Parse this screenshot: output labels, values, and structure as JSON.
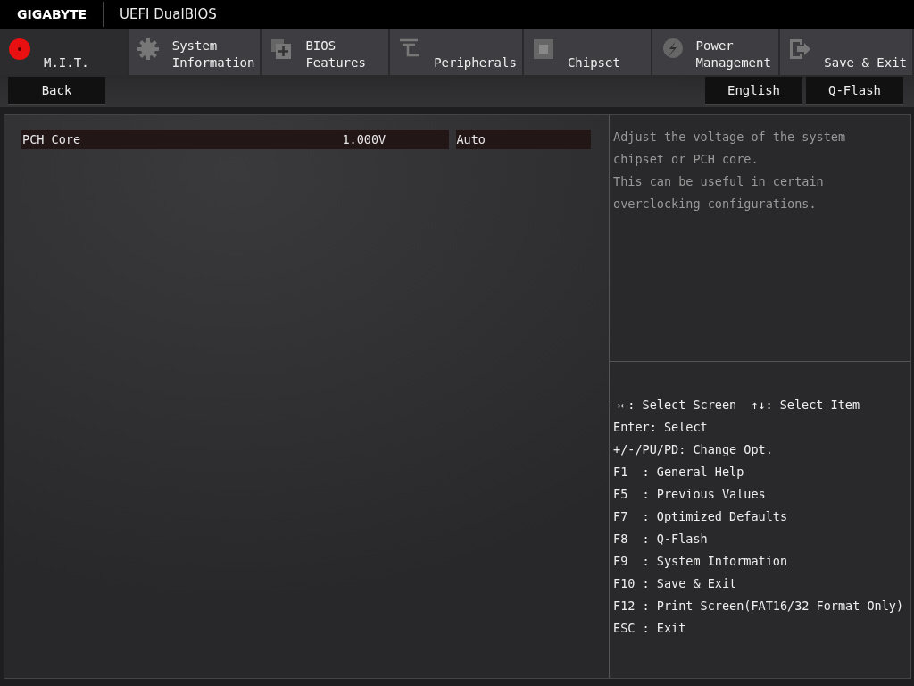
{
  "header": {
    "brand": "GIGABYTE",
    "title": "UEFI DualBIOS"
  },
  "tabs": [
    {
      "kind": "mit",
      "lines": [
        "M.I.T."
      ],
      "selected": true
    },
    {
      "kind": "gear",
      "lines": [
        "System",
        "Information"
      ],
      "selected": false
    },
    {
      "kind": "chip-plus",
      "lines": [
        "BIOS",
        "Features"
      ],
      "selected": false
    },
    {
      "kind": "plug",
      "lines": [
        "Peripherals"
      ],
      "selected": false
    },
    {
      "kind": "chip",
      "lines": [
        "Chipset"
      ],
      "selected": false
    },
    {
      "kind": "bolt",
      "lines": [
        "Power",
        "Management"
      ],
      "selected": false
    },
    {
      "kind": "exit",
      "lines": [
        "Save & Exit"
      ],
      "selected": false
    }
  ],
  "toolbar": {
    "back": "Back",
    "right_buttons": [
      "English",
      "Q-Flash"
    ]
  },
  "settings": [
    {
      "name": "PCH Core",
      "value": "1.000V",
      "option": "Auto",
      "selected": true
    }
  ],
  "help": {
    "lines": [
      "Adjust the voltage of the system",
      "chipset or PCH core.",
      "This can be useful in certain",
      "overclocking configurations."
    ]
  },
  "key_help": [
    [
      "→←: Select Screen",
      "↑↓: Select Item"
    ],
    [
      "Enter: Select"
    ],
    [
      "+/-/PU/PD: Change Opt."
    ],
    [
      "F1  : General Help"
    ],
    [
      "F5  : Previous Values"
    ],
    [
      "F7  : Optimized Defaults"
    ],
    [
      "F8  : Q-Flash"
    ],
    [
      "F9  : System Information"
    ],
    [
      "F10 : Save & Exit"
    ],
    [
      "F12 : Print Screen(FAT16/32 Format Only)"
    ],
    [
      "ESC : Exit"
    ]
  ]
}
